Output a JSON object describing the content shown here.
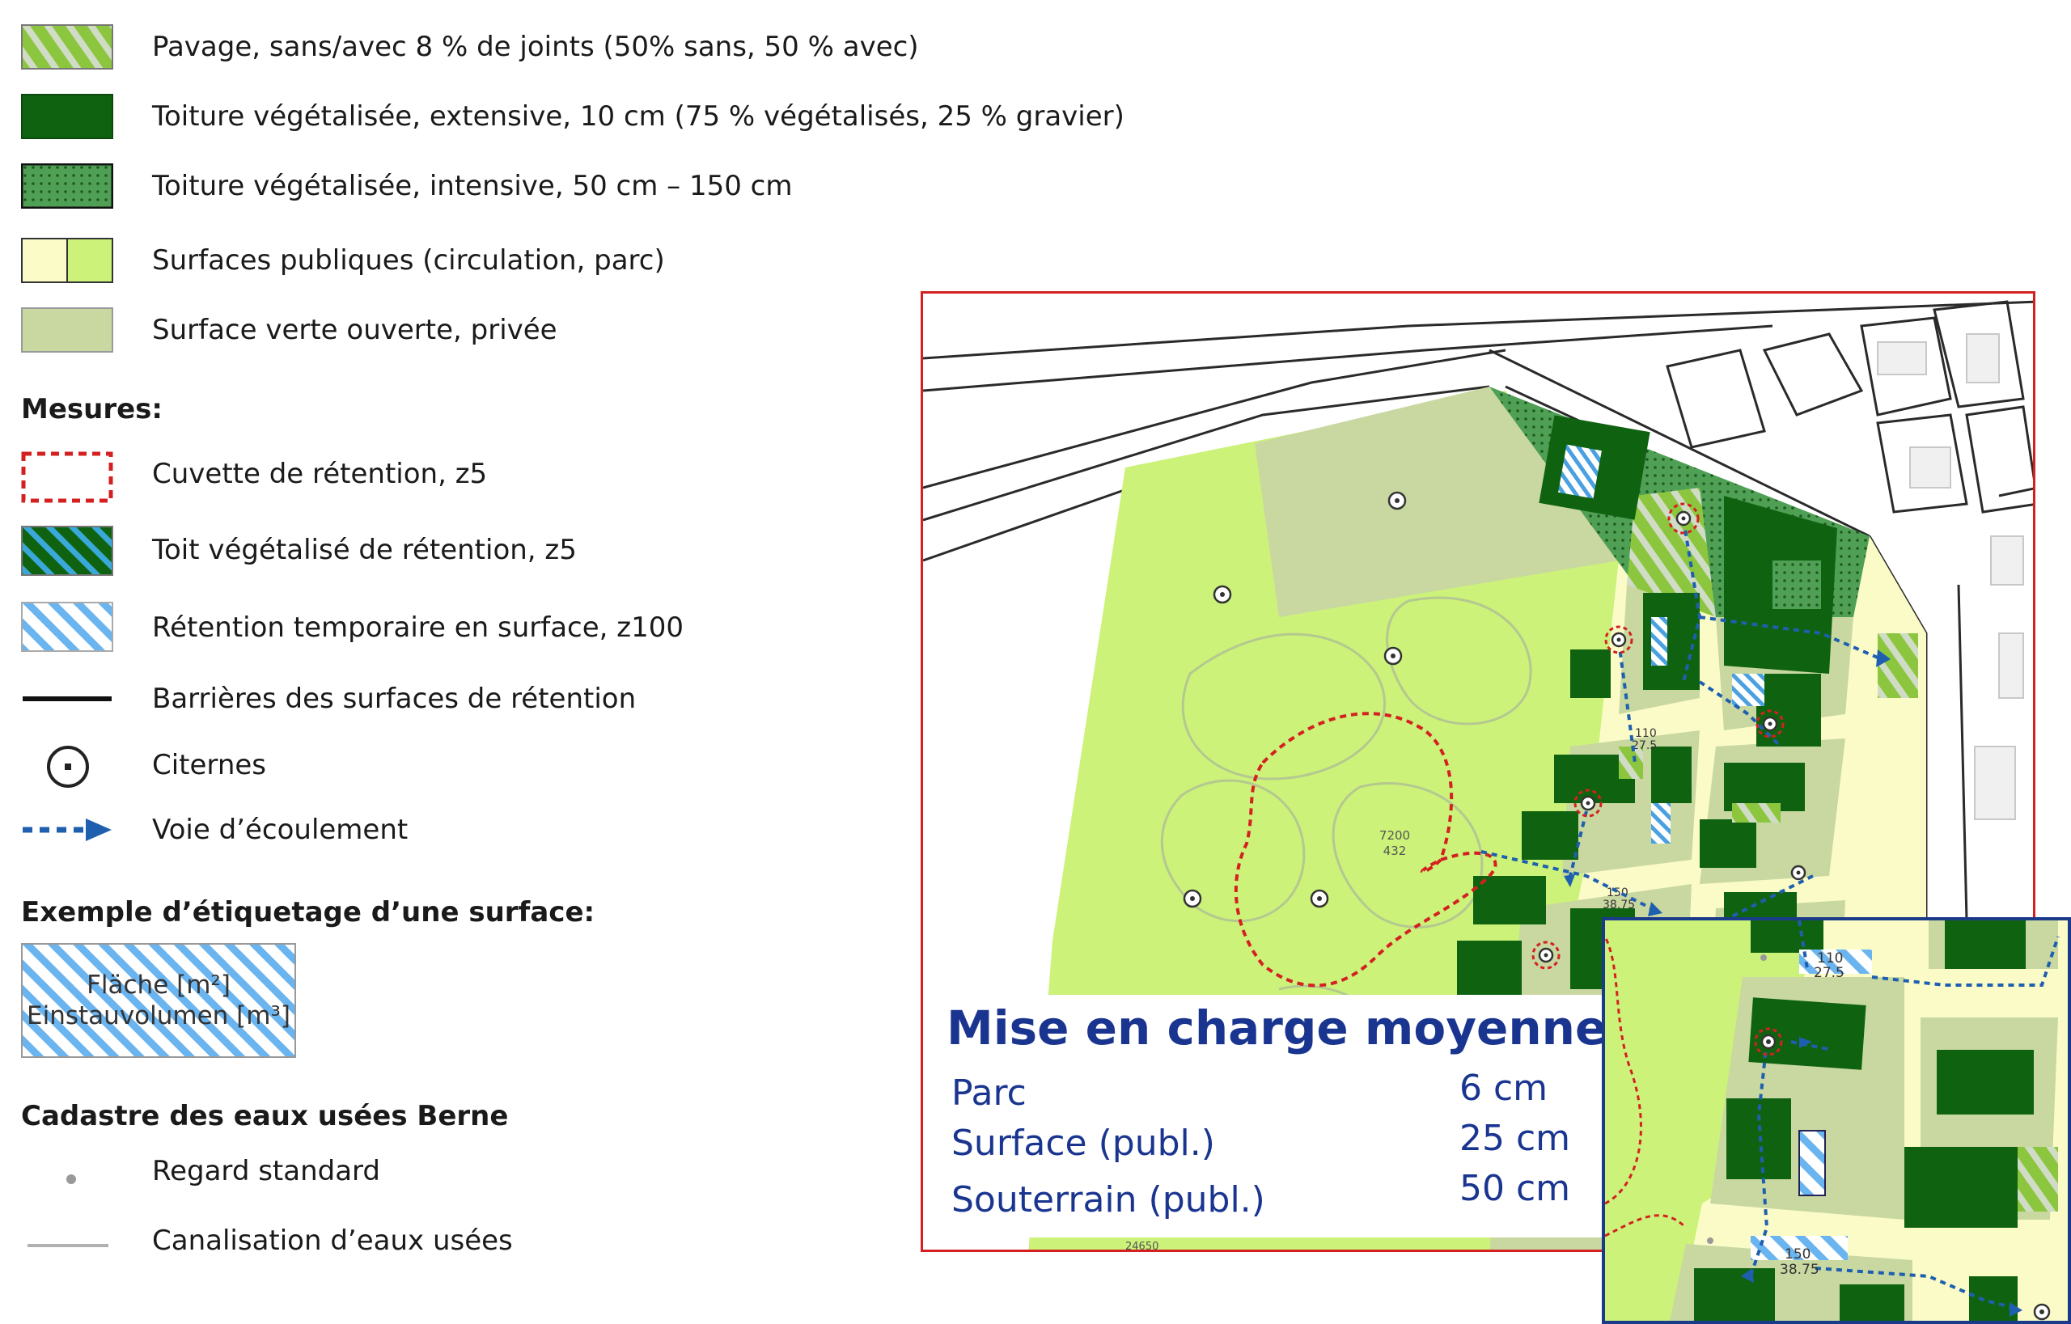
{
  "legend": {
    "items": [
      {
        "label": "Pavage, sans/avec 8 % de joints (50% sans, 50 % avec)",
        "icon": "hatched-green-swatch"
      },
      {
        "label": "Toiture végétalisée, extensive, 10 cm (75 % végétalisés, 25 % gravier)",
        "icon": "dark-green-swatch"
      },
      {
        "label": "Toiture végétalisée, intensive, 50 cm – 150 cm",
        "icon": "dotted-green-swatch"
      },
      {
        "label": "Surfaces publiques (circulation, parc)",
        "icon": "yellow-lime-split-swatch"
      },
      {
        "label": "Surface verte ouverte, privée",
        "icon": "sage-green-swatch"
      }
    ],
    "measures_heading": "Mesures:",
    "measures": [
      {
        "label": "Cuvette de rétention, z5",
        "icon": "red-dashed-outline-icon"
      },
      {
        "label": "Toit végétalisé de rétention, z5",
        "icon": "teal-hatched-swatch"
      },
      {
        "label": "Rétention temporaire en surface, z100",
        "icon": "blue-hatched-swatch"
      },
      {
        "label": "Barrières des surfaces de rétention",
        "icon": "black-line-icon"
      },
      {
        "label": "Citernes",
        "icon": "cistern-icon"
      },
      {
        "label": "Voie d’écoulement",
        "icon": "flow-arrow-icon"
      }
    ],
    "example_heading": "Exemple d’étiquetage d’une surface:",
    "example_line1": "Fläche [m²]",
    "example_line2": "Einstauvolumen [m³]",
    "cadastre_heading": "Cadastre des eaux usées Berne",
    "cadastre": [
      {
        "label": "Regard standard",
        "icon": "manhole-dot-icon"
      },
      {
        "label": "Canalisation d’eaux usées",
        "icon": "grey-line-icon"
      }
    ]
  },
  "map": {
    "parcel_label_1": "7200",
    "parcel_label_2": "432",
    "label_a1": "110",
    "label_a2": "27.5",
    "label_b1": "150",
    "label_b2": "38.75",
    "bottom_label": "24650"
  },
  "inset": {
    "label_a1": "110",
    "label_a2": "27.5",
    "label_b1": "150",
    "label_b2": "38.75"
  },
  "info": {
    "title": "Mise en charge moyenne",
    "rows": [
      {
        "label": "Parc",
        "value": "6 cm"
      },
      {
        "label": "Surface (publ.)",
        "value": "25 cm"
      },
      {
        "label": "Souterrain (publ.)",
        "value": "50 cm"
      }
    ]
  },
  "colors": {
    "park_green": "#ccf27a",
    "public_yellow": "#fbfbc8",
    "private_sage": "#c8d8a0",
    "roof_dark_green": "#0f6310",
    "retention_red": "#d42020",
    "flow_blue": "#1e5fb0",
    "frame_red": "#d42020",
    "inset_navy": "#1a3a8a",
    "info_text": "#1a3590"
  }
}
